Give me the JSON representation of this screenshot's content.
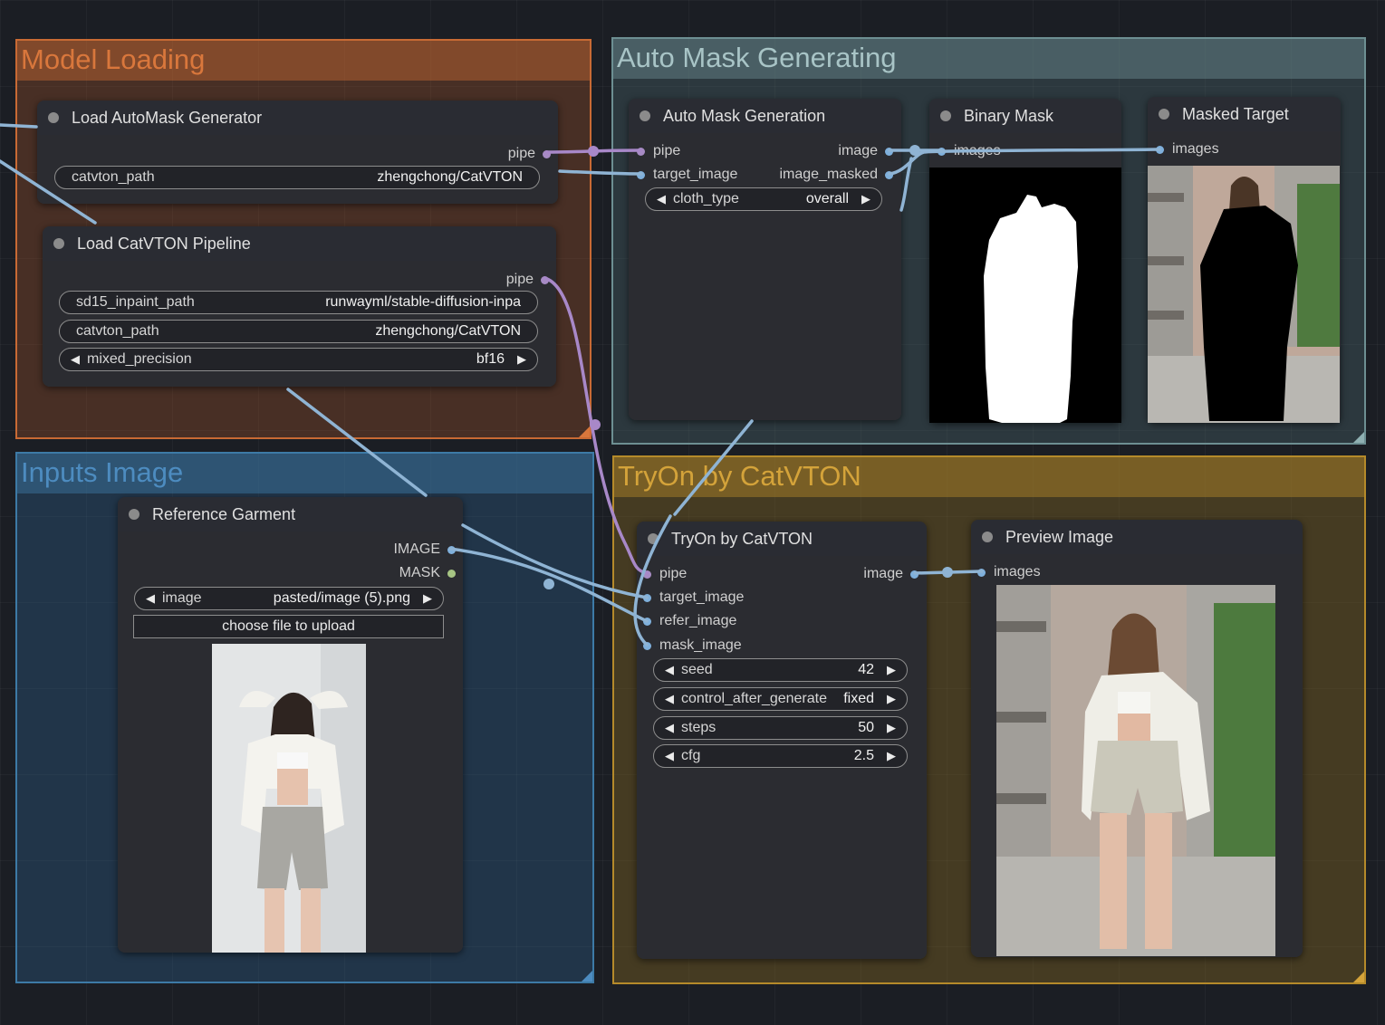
{
  "groups": {
    "model_loading": "Model Loading",
    "auto_mask": "Auto Mask Generating",
    "inputs_image": "Inputs Image",
    "tryon": "TryOn by CatVTON"
  },
  "nodes": {
    "load_automask": {
      "title": "Load AutoMask Generator",
      "output": "pipe",
      "widgets": [
        {
          "label": "catvton_path",
          "value": "zhengchong/CatVTON"
        }
      ]
    },
    "load_catvton": {
      "title": "Load CatVTON Pipeline",
      "output": "pipe",
      "widgets": [
        {
          "label": "sd15_inpaint_path",
          "value": "runwayml/stable-diffusion-inpa"
        },
        {
          "label": "catvton_path",
          "value": "zhengchong/CatVTON"
        },
        {
          "label": "mixed_precision",
          "value": "bf16"
        }
      ]
    },
    "auto_mask_gen": {
      "title": "Auto Mask Generation",
      "inputs": [
        "pipe",
        "target_image"
      ],
      "outputs": [
        "image",
        "image_masked"
      ],
      "widgets": [
        {
          "label": "cloth_type",
          "value": "overall"
        }
      ]
    },
    "binary_mask": {
      "title": "Binary Mask",
      "input": "images"
    },
    "masked_target": {
      "title": "Masked Target",
      "input": "images"
    },
    "reference_garment": {
      "title": "Reference Garment",
      "outputs": [
        "IMAGE",
        "MASK"
      ],
      "widgets": [
        {
          "label": "image",
          "value": "pasted/image (5).png"
        }
      ],
      "upload": "choose file to upload"
    },
    "tryon_node": {
      "title": "TryOn by CatVTON",
      "inputs": [
        "pipe",
        "target_image",
        "refer_image",
        "mask_image"
      ],
      "output": "image",
      "widgets": [
        {
          "label": "seed",
          "value": "42"
        },
        {
          "label": "control_after_generate",
          "value": "fixed"
        },
        {
          "label": "steps",
          "value": "50"
        },
        {
          "label": "cfg",
          "value": "2.5"
        }
      ]
    },
    "preview_image": {
      "title": "Preview Image",
      "input": "images"
    }
  },
  "colors": {
    "model_loading": "#c86a34",
    "auto_mask": "#6d8f92",
    "inputs_image": "#3d7aa6",
    "tryon": "#b58a2a",
    "wire_blue": "#8fb4d4",
    "wire_purple": "#a888c8"
  }
}
